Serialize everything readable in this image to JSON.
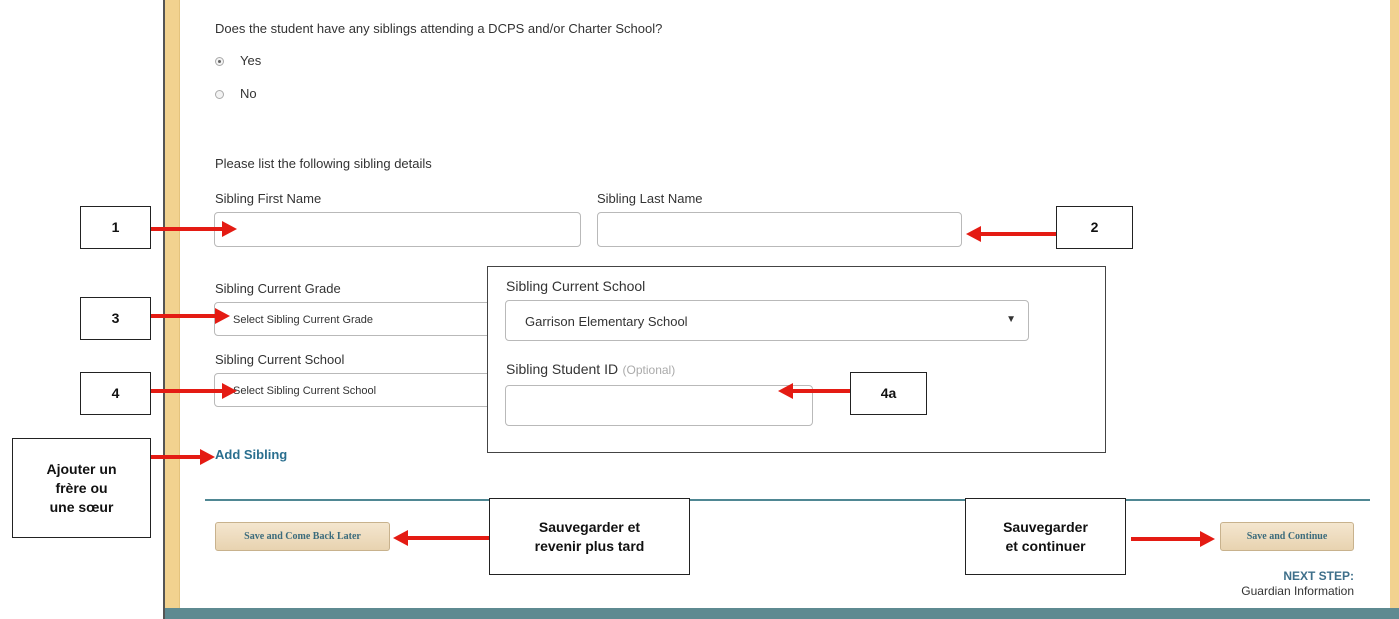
{
  "question": {
    "text": "Does the student have any siblings attending a DCPS and/or Charter School?",
    "options": [
      {
        "label": "Yes",
        "checked": true
      },
      {
        "label": "No",
        "checked": false
      }
    ]
  },
  "sibling_details": {
    "intro": "Please list the following sibling details",
    "first_name_label": "Sibling First Name",
    "last_name_label": "Sibling Last Name",
    "grade_label": "Sibling Current Grade",
    "grade_select": "Select Sibling Current Grade",
    "school_label": "Sibling Current School",
    "school_select": "Select Sibling Current School",
    "add_sibling": "Add Sibling"
  },
  "callout": {
    "school_label": "Sibling Current School",
    "school_value": "Garrison Elementary School",
    "student_id_label": "Sibling Student ID",
    "student_id_optional": "(Optional)"
  },
  "buttons": {
    "save_later": "Save and Come Back Later",
    "save_continue": "Save and Continue"
  },
  "next_step": {
    "label": "NEXT STEP:",
    "value": "Guardian Information"
  },
  "annotations": {
    "n1": "1",
    "n2": "2",
    "n3": "3",
    "n4": "4",
    "n4a": "4a",
    "add_line1": "Ajouter un",
    "add_line2": "frère ou",
    "add_line3": "une sœur",
    "save_later_line1": "Sauvegarder et",
    "save_later_line2": "revenir plus tard",
    "save_continue_line1": "Sauvegarder",
    "save_continue_line2": "et continuer"
  },
  "colors": {
    "tan_border": "#f2d28f",
    "arrow_red": "#e41b13",
    "link_blue": "#2a6f8f",
    "divider_teal": "#4f8793",
    "footer_bar": "#5e8a91"
  }
}
